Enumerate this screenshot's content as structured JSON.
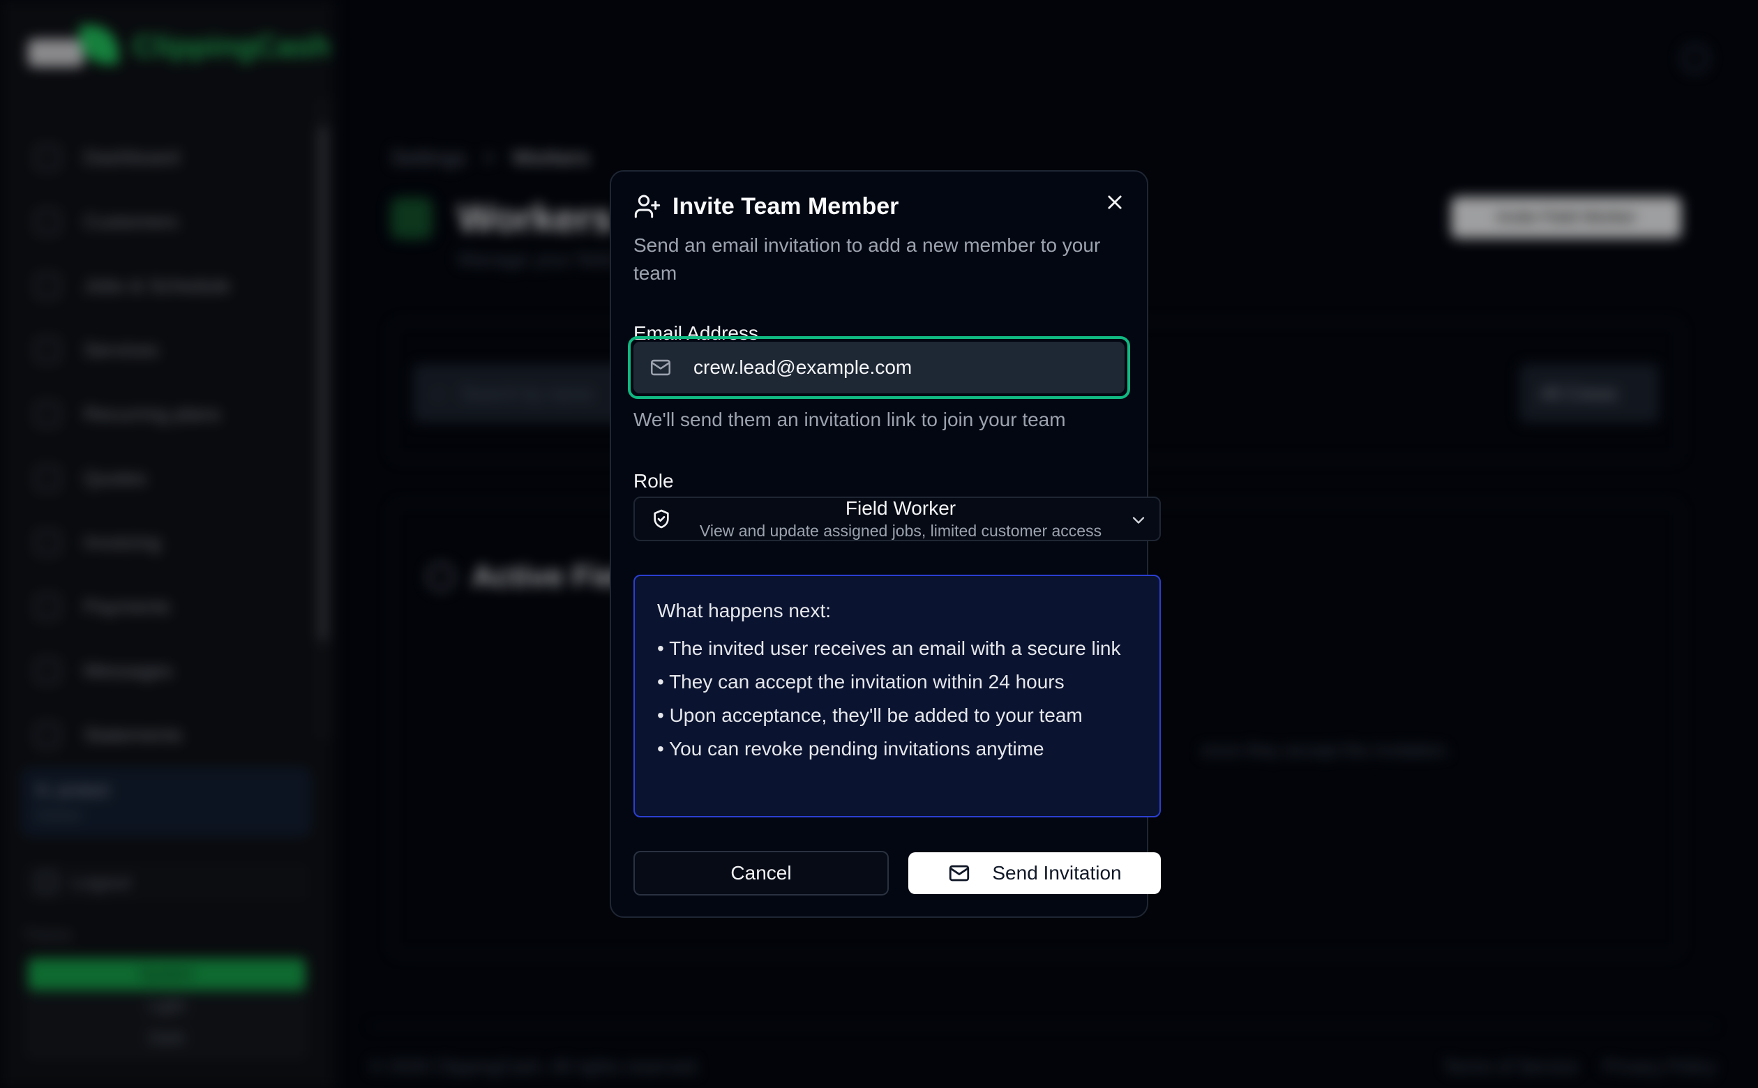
{
  "app": {
    "brand": "ClippingCash",
    "nav": [
      "Dashboard",
      "Customers",
      "Jobs & Schedule",
      "Services",
      "Recurring plans",
      "Quotes",
      "Invoicing",
      "Payments",
      "Messages",
      "Statements"
    ],
    "user": {
      "name": "N. protest",
      "role": "Owner"
    },
    "logout_label": "Logout",
    "theme": {
      "label": "Theme",
      "options": [
        "System",
        "Light",
        "Dark"
      ],
      "selected": "System"
    },
    "breadcrumb": {
      "parent": "Settings",
      "separator": ">",
      "current": "Workers"
    },
    "page_title": "Workers",
    "page_subtitle": "Manage your field workers",
    "invite_button": "Invite Field Worker",
    "search_placeholder": "Search by name",
    "crew_filter": "All Crews",
    "section_title": "Active Field Workers",
    "empty_hint": "once they accept the invitation.",
    "footer": {
      "copyright": "© 2026 ClippingCash. All rights reserved.",
      "terms": "Terms of Service",
      "privacy": "Privacy Policy"
    }
  },
  "modal": {
    "title": "Invite Team Member",
    "description": "Send an email invitation to add a new member to your team",
    "email": {
      "label": "Email Address",
      "value": "crew.lead@example.com",
      "help": "We'll send them an invitation link to join your team"
    },
    "role": {
      "label": "Role",
      "selected_name": "Field Worker",
      "selected_description": "View and update assigned jobs, limited customer access"
    },
    "info": {
      "heading": "What happens next:",
      "items": [
        "• The invited user receives an email with a secure link",
        "• They can accept the invitation within 24 hours",
        "• Upon acceptance, they'll be added to your team",
        "• You can revoke pending invitations anytime"
      ]
    },
    "cancel_label": "Cancel",
    "send_label": "Send Invitation"
  },
  "colors": {
    "accent_focus": "#10b981",
    "info_border": "#2b3fd1",
    "brand_green": "#22c55e"
  }
}
